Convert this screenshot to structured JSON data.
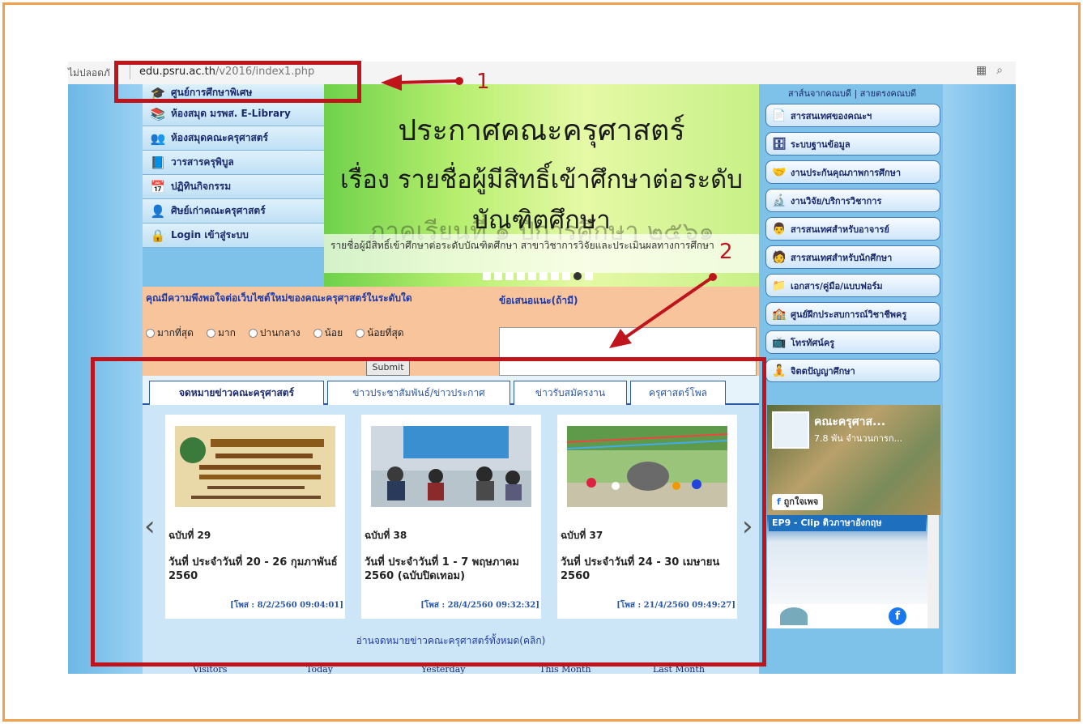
{
  "browser": {
    "insecure_label": "ไม่ปลอดภั",
    "url_host": "edu.psru.ac.th",
    "url_path": "/v2016/index1.php"
  },
  "left_menu": [
    {
      "label": "ศูนย์การศึกษาพิเศษ",
      "icon": "graduation-cap-icon"
    },
    {
      "label": "ห้องสมุด มรพส. E-Library",
      "icon": "books-icon"
    },
    {
      "label": "ห้องสมุดคณะครุศาสตร์",
      "icon": "people-icon"
    },
    {
      "label": "วารสารครุพิบูล",
      "icon": "journal-icon"
    },
    {
      "label": "ปฏิทินกิจกรรม",
      "icon": "calendar-icon"
    },
    {
      "label": "ศิษย์เก่าคณะครุศาสตร์",
      "icon": "alumni-icon"
    },
    {
      "label": "Login เข้าสู่ระบบ",
      "icon": "lock-icon"
    }
  ],
  "banner": {
    "title": "ประกาศคณะครุศาสตร์",
    "subtitle": "เรื่อง รายชื่อผู้มีสิทธิ์เข้าศึกษาต่อระดับบัณฑิตศึกษา",
    "ghost_line": "ภาคเรียนที่ ๑ ปีการศึกษา ๒๕๖๑",
    "caption": "รายชื่อผู้มีสิทธิ์เข้าศึกษาต่อระดับบัณฑิตศึกษา สาขาวิชาการวิจัยและประเมินผลทางการศึกษา"
  },
  "survey": {
    "question": "คุณมีความพึงพอใจต่อเว็บไซต์ใหม่ของคณะครุศาสตร์ในระดับใด",
    "options": [
      "มากที่สุด",
      "มาก",
      "ปานกลาง",
      "น้อย",
      "น้อยที่สุด"
    ],
    "suggestion_label": "ข้อเสนอแนะ(ถ้ามี)",
    "submit_label": "Submit"
  },
  "news": {
    "tabs": [
      "จดหมายข่าวคณะครุศาสตร์",
      "ข่าวประชาสัมพันธ์/ข่าวประกาศ",
      "ข่าวรับสมัครงาน",
      "ครุศาสตร์โพล"
    ],
    "cards": [
      {
        "issue": "ฉบับที่ 29",
        "desc": "วันที่ ประจำวันที่ 20 - 26 กุมภาพันธ์ 2560",
        "date": "[โพส : 8/2/2560 09:04:01]"
      },
      {
        "issue": "ฉบับที่ 38",
        "desc": "วันที่ ประจำวันที่ 1 - 7 พฤษภาคม 2560 (ฉบับปิดเทอม)",
        "date": "[โพส : 28/4/2560 09:32:32]"
      },
      {
        "issue": "ฉบับที่ 37",
        "desc": "วันที่ ประจำวันที่ 24 - 30 เมษายน 2560",
        "date": "[โพส : 21/4/2560 09:49:27]"
      }
    ],
    "more_link": "อ่านจดหมายข่าวคณะครุศาสตร์ทั้งหมด(คลิก)"
  },
  "visitors": [
    "Visitors",
    "Today",
    "Yesterday",
    "This Month",
    "Last Month"
  ],
  "right_col": {
    "header_a": "สาส์นจากคณบดี",
    "header_b": "สายตรงคณบดี",
    "buttons": [
      {
        "label": "สารสนเทศของคณะฯ",
        "icon": "document-icon"
      },
      {
        "label": "ระบบฐานข้อมูล",
        "icon": "database-icon"
      },
      {
        "label": "งานประกันคุณภาพการศึกษา",
        "icon": "handshake-icon"
      },
      {
        "label": "งานวิจัย/บริการวิชาการ",
        "icon": "research-icon"
      },
      {
        "label": "สารสนเทศสำหรับอาจารย์",
        "icon": "teacher-icon"
      },
      {
        "label": "สารสนเทศสำหรับนักศึกษา",
        "icon": "student-icon"
      },
      {
        "label": "เอกสาร/คู่มือ/แบบฟอร์ม",
        "icon": "folder-icon"
      },
      {
        "label": "ศูนย์ฝึกประสบการณ์วิชาชีพครู",
        "icon": "training-icon"
      },
      {
        "label": "โทรทัศน์ครู",
        "icon": "tv-icon"
      },
      {
        "label": "จิตตปัญญาศึกษา",
        "icon": "meditation-icon"
      }
    ],
    "fb_name": "คณะครุศาส...",
    "fb_count": "7.8 พัน จำนวนการก...",
    "fb_like": "ถูกใจเพจ",
    "yt_title": "EP9 - Clip ติวภาษาอังกฤษ"
  },
  "annotations": {
    "one": "1",
    "two": "2"
  },
  "colors": {
    "annotation": "#c0141c",
    "frame": "#f0a04a",
    "page_bg": "#7ec2ea"
  }
}
